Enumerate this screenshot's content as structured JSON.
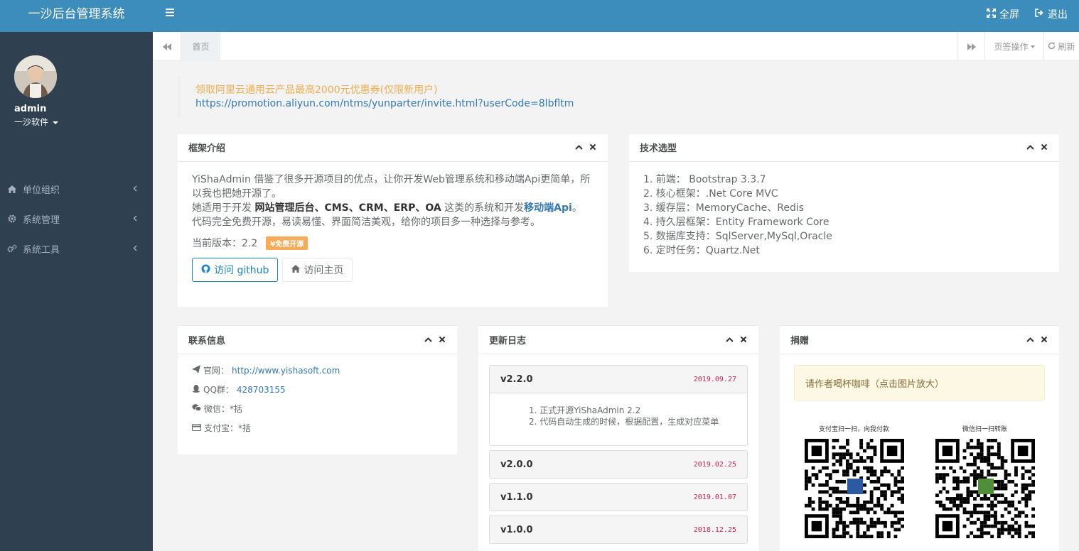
{
  "app": {
    "title": "一沙后台管理系统"
  },
  "user": {
    "name": "admin",
    "org": "一沙软件"
  },
  "sidebar": {
    "items": [
      {
        "label": "单位组织",
        "icon": "home-icon"
      },
      {
        "label": "系统管理",
        "icon": "gear-icon"
      },
      {
        "label": "系统工具",
        "icon": "gears-icon"
      }
    ]
  },
  "header": {
    "fullscreen": "全屏",
    "logout": "退出"
  },
  "tabs": {
    "home": "首页",
    "page_ops": "页签操作",
    "refresh": "刷新"
  },
  "promo": {
    "title": "领取阿里云通用云产品最高2000元优惠券(仅限新用户)",
    "link": "https://promotion.aliyun.com/ntms/yunparter/invite.html?userCode=8lbfltm"
  },
  "intro": {
    "title": "框架介绍",
    "line1": "YiShaAdmin 借鉴了很多开源项目的优点，让你开发Web管理系统和移动端Api更简单，所以我也把她开源了。",
    "line2_pre": "她适用于开发 ",
    "line2_bold": "网站管理后台、CMS、CRM、ERP、OA",
    "line2_mid": " 这类的系统和开发",
    "line2_hl": "移动端Api",
    "line2_end": "。",
    "line3": "代码完全免费开源，易读易懂、界面简洁美观，给你的项目多一种选择与参考。",
    "version": "当前版本：2.2",
    "badge": "¥免费开源",
    "btn_github": "访问 github",
    "btn_home": "访问主页"
  },
  "tech": {
    "title": "技术选型",
    "items": [
      "1. 前端： Bootstrap 3.3.7",
      "2. 核心框架：.Net Core MVC",
      "3. 缓存层：MemoryCache、Redis",
      "4. 持久层框架：Entity Framework Core",
      "5. 数据库支持：SqlServer,MySql,Oracle",
      "6. 定时任务：Quartz.Net"
    ]
  },
  "contact": {
    "title": "联系信息",
    "site_label": "官网：",
    "site_value": "http://www.yishasoft.com",
    "qq_label": "QQ群：",
    "qq_value": "428703155",
    "wechat": "微信：*括",
    "alipay": "支付宝：*括"
  },
  "changelog": {
    "title": "更新日志",
    "entries": [
      {
        "version": "v2.2.0",
        "date": "2019.09.27",
        "notes": [
          "1. 正式开源YiShaAdmin 2.2",
          "2. 代码自动生成的时候，根据配置，生成对应菜单"
        ]
      },
      {
        "version": "v2.0.0",
        "date": "2019.02.25"
      },
      {
        "version": "v1.1.0",
        "date": "2019.01.07"
      },
      {
        "version": "v1.0.0",
        "date": "2018.12.25"
      }
    ]
  },
  "donate": {
    "title": "捐赠",
    "alert": "请作者喝杯咖啡（点击图片放大）",
    "alipay_caption": "支付宝扫一扫，向我付款",
    "wechat_caption": "微信扫一扫转账"
  },
  "colors": {
    "header": "#3c8dbc",
    "sidebar": "#2f4050",
    "promo": "#f0ad4e",
    "link": "#337ab7",
    "badge": "#f8ac59",
    "date": "#c7254e"
  }
}
